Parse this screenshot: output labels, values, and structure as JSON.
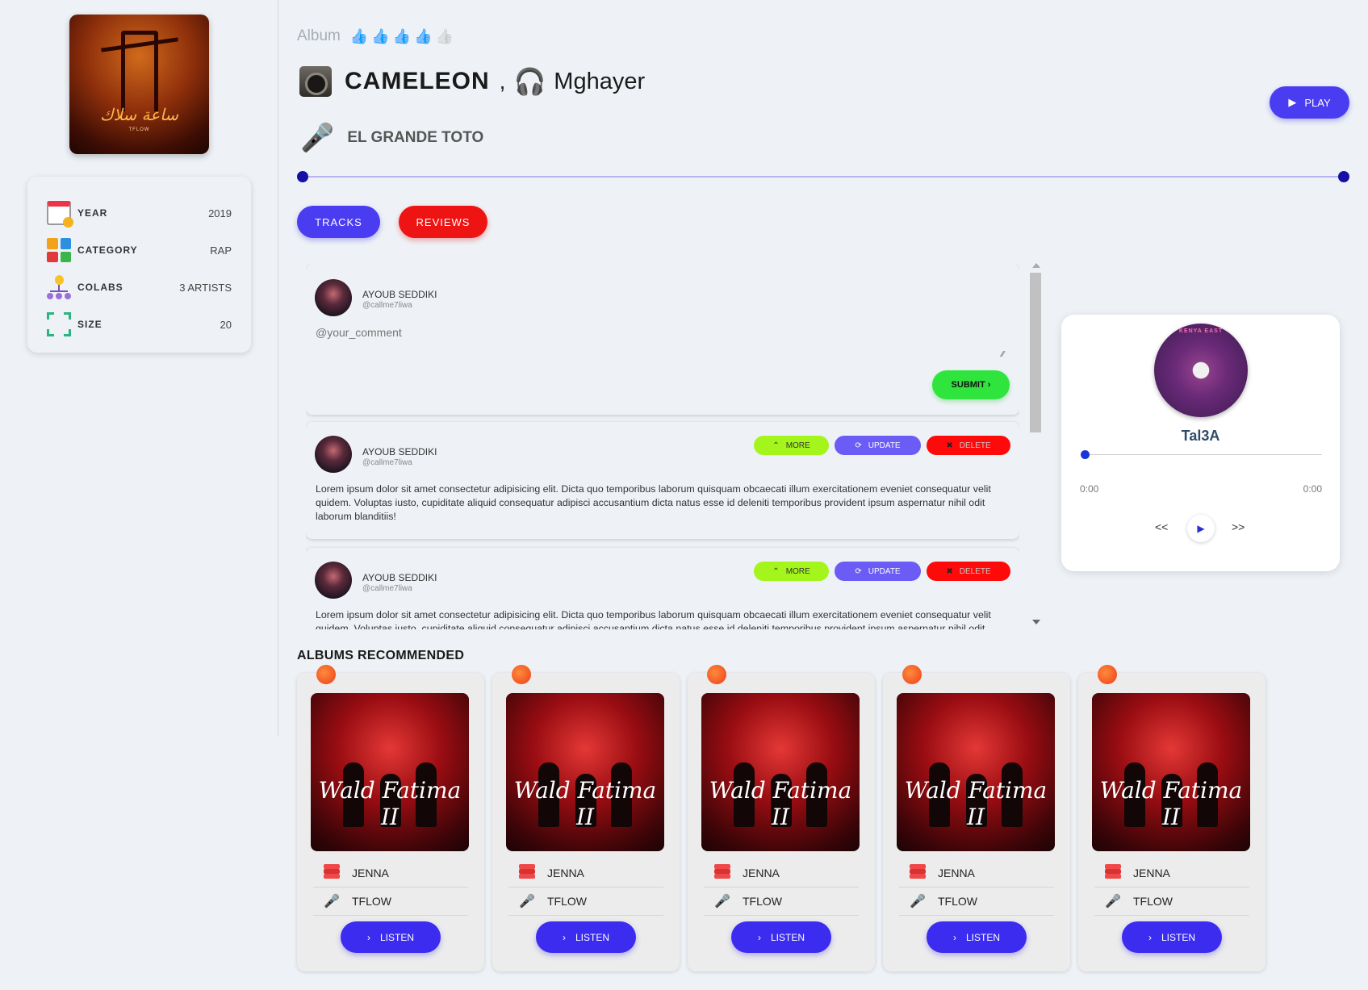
{
  "album": {
    "label": "Album",
    "rating": 4,
    "rating_max": 5,
    "title": "CAMELEON",
    "separator": ",",
    "title_secondary": "Mghayer",
    "artist": "EL GRANDE TOTO",
    "play_label": "PLAY"
  },
  "info": [
    {
      "label": "YEAR",
      "value": "2019",
      "icon": "calendar-icon"
    },
    {
      "label": "CATEGORY",
      "value": "RAP",
      "icon": "category-grid-icon"
    },
    {
      "label": "COLABS",
      "value": "3 ARTISTS",
      "icon": "collab-icon"
    },
    {
      "label": "SIZE",
      "value": "20",
      "icon": "expand-icon"
    }
  ],
  "tabs": {
    "tracks": "TRACKS",
    "reviews": "REVIEWS"
  },
  "comment_form": {
    "user": "AYOUB SEDDIKI",
    "handle": "@callme7liwa",
    "placeholder": "@your_comment",
    "submit": "SUBMIT ›"
  },
  "reviews": [
    {
      "user": "AYOUB SEDDIKI",
      "handle": "@callme7liwa",
      "text": "Lorem ipsum dolor sit amet consectetur adipisicing elit. Dicta quo temporibus laborum quisquam obcaecati illum exercitationem eveniet consequatur velit quidem. Voluptas iusto, cupiditate aliquid consequatur adipisci accusantium dicta natus esse id deleniti temporibus provident ipsum aspernatur nihil odit laborum blanditiis!"
    },
    {
      "user": "AYOUB SEDDIKI",
      "handle": "@callme7liwa",
      "text": "Lorem ipsum dolor sit amet consectetur adipisicing elit. Dicta quo temporibus laborum quisquam obcaecati illum exercitationem eveniet consequatur velit quidem. Voluptas iusto, cupiditate aliquid consequatur adipisci accusantium dicta natus esse id deleniti temporibus provident ipsum aspernatur nihil odit laborum blanditiis!"
    }
  ],
  "review_actions": {
    "more": "MORE",
    "update": "UPDATE",
    "delete": "DELETE"
  },
  "player": {
    "track": "Tal3A",
    "current_time": "0:00",
    "total_time": "0:00",
    "prev": "<<",
    "next": ">>"
  },
  "recommended": {
    "title": "ALBUMS RECOMMENDED",
    "items": [
      {
        "name": "JENNA",
        "artist": "TFLOW",
        "button": "LISTEN"
      },
      {
        "name": "JENNA",
        "artist": "TFLOW",
        "button": "LISTEN"
      },
      {
        "name": "JENNA",
        "artist": "TFLOW",
        "button": "LISTEN"
      },
      {
        "name": "JENNA",
        "artist": "TFLOW",
        "button": "LISTEN"
      },
      {
        "name": "JENNA",
        "artist": "TFLOW",
        "button": "LISTEN"
      }
    ]
  },
  "colors": {
    "primary": "#4a3cf0",
    "danger": "#ef1414",
    "success": "#2fe53d",
    "lime": "#a4f51c",
    "rating_on": "#1a2fd8",
    "rating_off": "#c8c8c8"
  }
}
